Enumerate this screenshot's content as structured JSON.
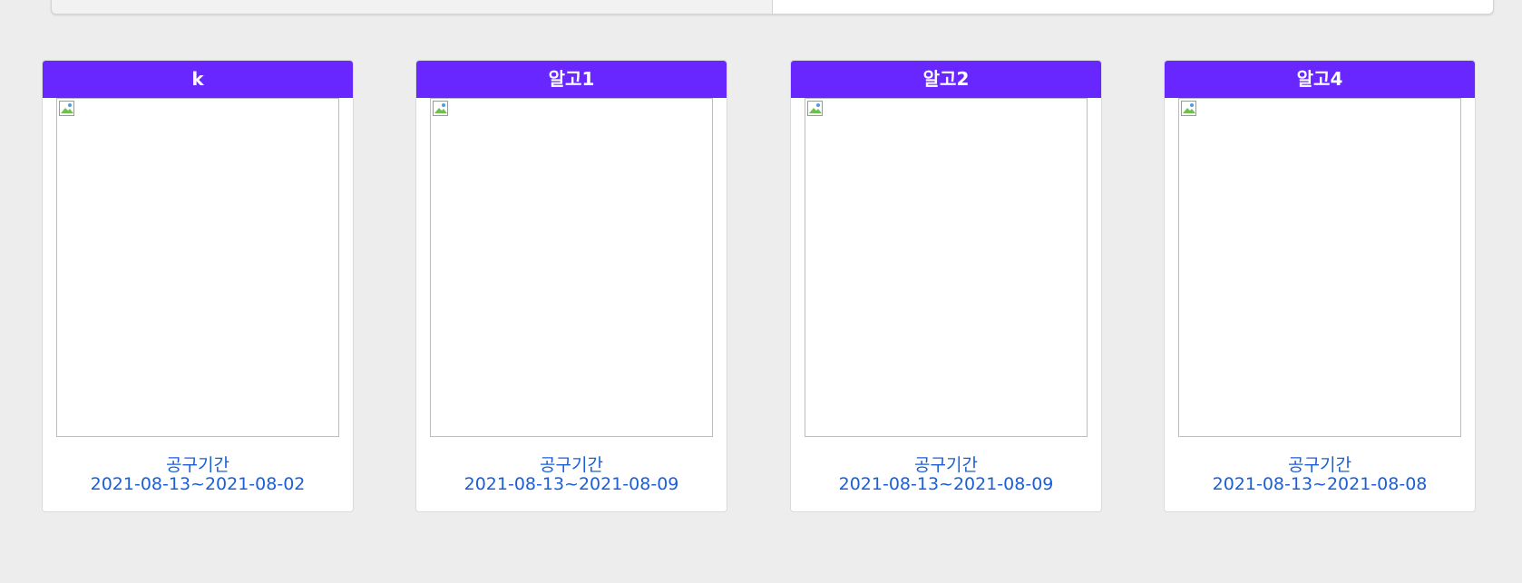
{
  "cards": [
    {
      "title": "k",
      "period_label": "공구기간",
      "period": "2021-08-13~2021-08-02"
    },
    {
      "title": "알고1",
      "period_label": "공구기간",
      "period": "2021-08-13~2021-08-09"
    },
    {
      "title": "알고2",
      "period_label": "공구기간",
      "period": "2021-08-13~2021-08-09"
    },
    {
      "title": "알고4",
      "period_label": "공구기간",
      "period": "2021-08-13~2021-08-08"
    }
  ],
  "colors": {
    "header": "#6827ff",
    "link_text": "#1a5fd8",
    "background": "#ededed"
  },
  "icons": {
    "image_placeholder": "broken-image-icon"
  }
}
